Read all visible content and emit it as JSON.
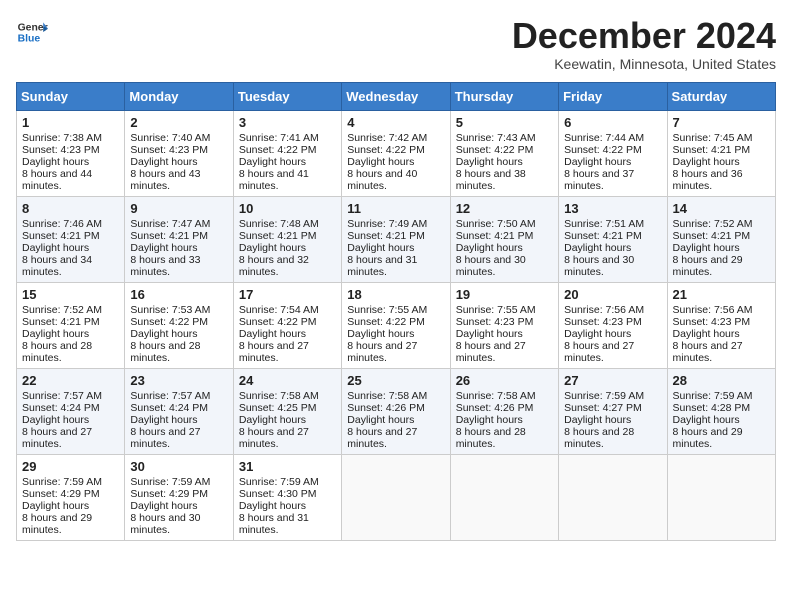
{
  "header": {
    "logo_line1": "General",
    "logo_line2": "Blue",
    "title": "December 2024",
    "subtitle": "Keewatin, Minnesota, United States"
  },
  "weekdays": [
    "Sunday",
    "Monday",
    "Tuesday",
    "Wednesday",
    "Thursday",
    "Friday",
    "Saturday"
  ],
  "weeks": [
    [
      {
        "day": "1",
        "rise": "7:38 AM",
        "set": "4:23 PM",
        "daylight": "8 hours and 44 minutes."
      },
      {
        "day": "2",
        "rise": "7:40 AM",
        "set": "4:23 PM",
        "daylight": "8 hours and 43 minutes."
      },
      {
        "day": "3",
        "rise": "7:41 AM",
        "set": "4:22 PM",
        "daylight": "8 hours and 41 minutes."
      },
      {
        "day": "4",
        "rise": "7:42 AM",
        "set": "4:22 PM",
        "daylight": "8 hours and 40 minutes."
      },
      {
        "day": "5",
        "rise": "7:43 AM",
        "set": "4:22 PM",
        "daylight": "8 hours and 38 minutes."
      },
      {
        "day": "6",
        "rise": "7:44 AM",
        "set": "4:22 PM",
        "daylight": "8 hours and 37 minutes."
      },
      {
        "day": "7",
        "rise": "7:45 AM",
        "set": "4:21 PM",
        "daylight": "8 hours and 36 minutes."
      }
    ],
    [
      {
        "day": "8",
        "rise": "7:46 AM",
        "set": "4:21 PM",
        "daylight": "8 hours and 34 minutes."
      },
      {
        "day": "9",
        "rise": "7:47 AM",
        "set": "4:21 PM",
        "daylight": "8 hours and 33 minutes."
      },
      {
        "day": "10",
        "rise": "7:48 AM",
        "set": "4:21 PM",
        "daylight": "8 hours and 32 minutes."
      },
      {
        "day": "11",
        "rise": "7:49 AM",
        "set": "4:21 PM",
        "daylight": "8 hours and 31 minutes."
      },
      {
        "day": "12",
        "rise": "7:50 AM",
        "set": "4:21 PM",
        "daylight": "8 hours and 30 minutes."
      },
      {
        "day": "13",
        "rise": "7:51 AM",
        "set": "4:21 PM",
        "daylight": "8 hours and 30 minutes."
      },
      {
        "day": "14",
        "rise": "7:52 AM",
        "set": "4:21 PM",
        "daylight": "8 hours and 29 minutes."
      }
    ],
    [
      {
        "day": "15",
        "rise": "7:52 AM",
        "set": "4:21 PM",
        "daylight": "8 hours and 28 minutes."
      },
      {
        "day": "16",
        "rise": "7:53 AM",
        "set": "4:22 PM",
        "daylight": "8 hours and 28 minutes."
      },
      {
        "day": "17",
        "rise": "7:54 AM",
        "set": "4:22 PM",
        "daylight": "8 hours and 27 minutes."
      },
      {
        "day": "18",
        "rise": "7:55 AM",
        "set": "4:22 PM",
        "daylight": "8 hours and 27 minutes."
      },
      {
        "day": "19",
        "rise": "7:55 AM",
        "set": "4:23 PM",
        "daylight": "8 hours and 27 minutes."
      },
      {
        "day": "20",
        "rise": "7:56 AM",
        "set": "4:23 PM",
        "daylight": "8 hours and 27 minutes."
      },
      {
        "day": "21",
        "rise": "7:56 AM",
        "set": "4:23 PM",
        "daylight": "8 hours and 27 minutes."
      }
    ],
    [
      {
        "day": "22",
        "rise": "7:57 AM",
        "set": "4:24 PM",
        "daylight": "8 hours and 27 minutes."
      },
      {
        "day": "23",
        "rise": "7:57 AM",
        "set": "4:24 PM",
        "daylight": "8 hours and 27 minutes."
      },
      {
        "day": "24",
        "rise": "7:58 AM",
        "set": "4:25 PM",
        "daylight": "8 hours and 27 minutes."
      },
      {
        "day": "25",
        "rise": "7:58 AM",
        "set": "4:26 PM",
        "daylight": "8 hours and 27 minutes."
      },
      {
        "day": "26",
        "rise": "7:58 AM",
        "set": "4:26 PM",
        "daylight": "8 hours and 28 minutes."
      },
      {
        "day": "27",
        "rise": "7:59 AM",
        "set": "4:27 PM",
        "daylight": "8 hours and 28 minutes."
      },
      {
        "day": "28",
        "rise": "7:59 AM",
        "set": "4:28 PM",
        "daylight": "8 hours and 29 minutes."
      }
    ],
    [
      {
        "day": "29",
        "rise": "7:59 AM",
        "set": "4:29 PM",
        "daylight": "8 hours and 29 minutes."
      },
      {
        "day": "30",
        "rise": "7:59 AM",
        "set": "4:29 PM",
        "daylight": "8 hours and 30 minutes."
      },
      {
        "day": "31",
        "rise": "7:59 AM",
        "set": "4:30 PM",
        "daylight": "8 hours and 31 minutes."
      },
      null,
      null,
      null,
      null
    ]
  ]
}
